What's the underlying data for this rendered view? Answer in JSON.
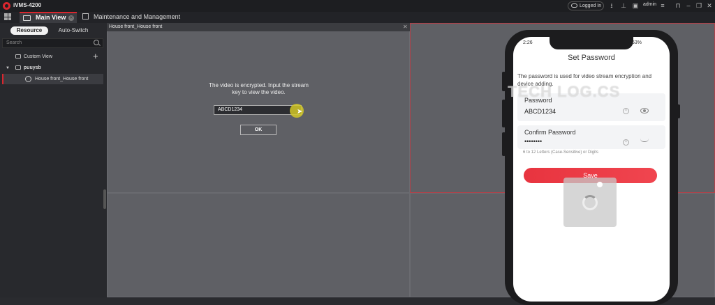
{
  "app": {
    "title": "iVMS-4200",
    "logged_in": "Logged In",
    "user": "admin"
  },
  "tabs": [
    {
      "label": "Main View"
    },
    {
      "label": "Maintenance and Management"
    }
  ],
  "sidebar": {
    "segments": [
      "Resource",
      "Auto-Switch"
    ],
    "search_placeholder": "Search",
    "custom_view": "Custom View",
    "group": "puuysb",
    "camera": "House front_House front"
  },
  "video": {
    "pane_title": "House front_House front",
    "encrypted_message": "The video is encrypted. Input the stream key to view the video.",
    "stream_key_value": "ABCD1234",
    "ok_label": "OK"
  },
  "phone": {
    "time": "2:26",
    "status_right": "63%",
    "title": "Set Password",
    "description": "The password is used for video stream encryption and device adding.",
    "password_label": "Password",
    "password_value": "ABCD1234",
    "confirm_label": "Confirm Password",
    "confirm_value": "••••••••",
    "hint": "6 to 12 Letters (Case-Sensitive) or Digits",
    "save_label": "Save"
  },
  "watermark": "TECH LOG.CS",
  "colors": {
    "accent": "#d9262e",
    "save_button": "#e8343f",
    "panel_bg": "#5f6065",
    "sidebar_bg": "#28292d"
  }
}
